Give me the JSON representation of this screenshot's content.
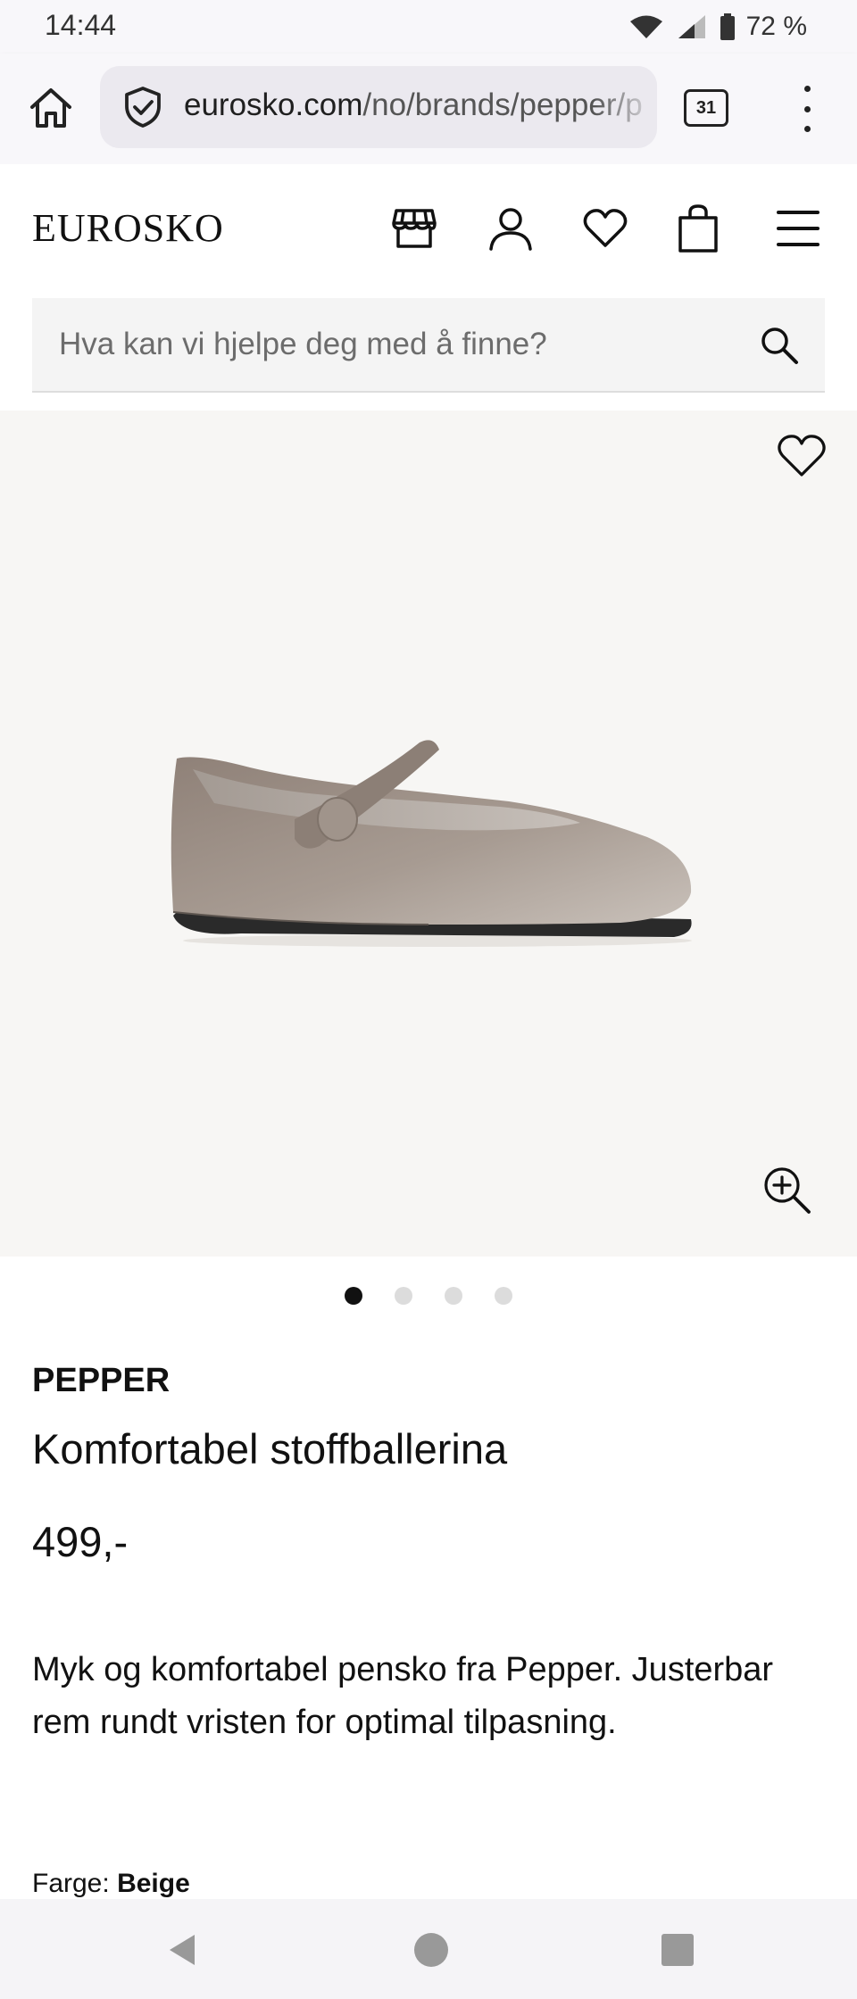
{
  "status_bar": {
    "time": "14:44",
    "battery": "72 %"
  },
  "browser": {
    "url_host": "eurosko.com",
    "url_path": "/no/brands/pepper/p",
    "tab_count": "31"
  },
  "site": {
    "logo": "EUROSKO"
  },
  "search": {
    "placeholder": "Hva kan vi hjelpe deg med å finne?"
  },
  "gallery": {
    "image_count": 4,
    "active_index": 0
  },
  "product": {
    "brand": "PEPPER",
    "title": "Komfortabel stoffballerina",
    "price": "499,-",
    "description": "Myk og komfortabel pensko fra Pepper. Justerbar rem rundt vristen for optimal tilpasning.",
    "color_label": "Farge:",
    "color_value": "Beige"
  },
  "icons": {
    "header": [
      "store-icon",
      "account-icon",
      "heart-icon",
      "bag-icon",
      "menu-icon"
    ],
    "nav": [
      "back-icon",
      "home-icon",
      "recents-icon"
    ]
  },
  "colors": {
    "image_bg": "#f7f6f4",
    "shoe": "#9a8e85",
    "active_dot": "#111111",
    "inactive_dot": "#dcdcdc"
  }
}
